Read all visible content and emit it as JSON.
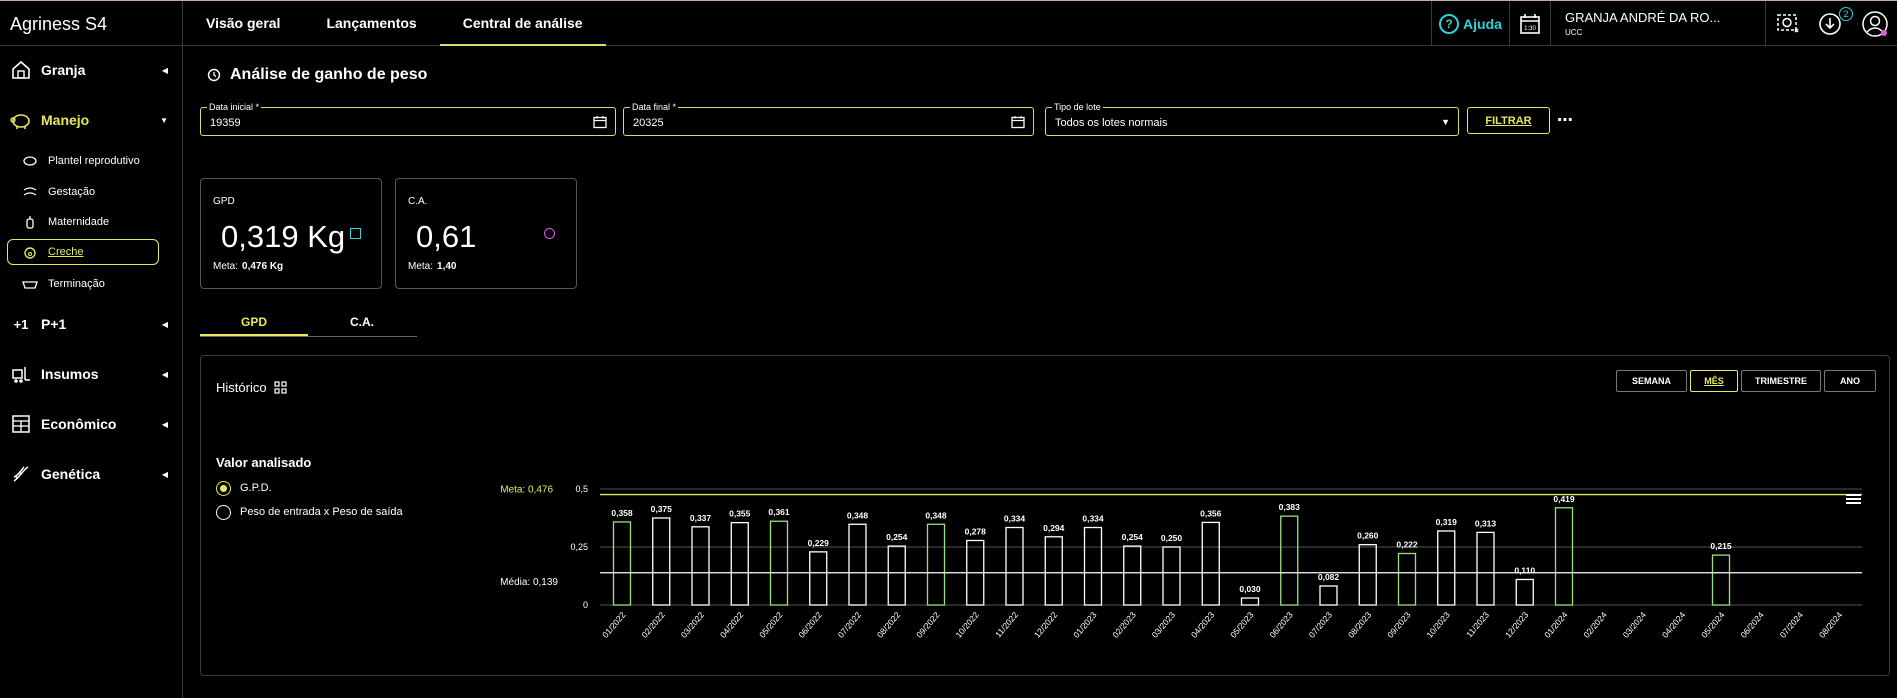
{
  "app": {
    "brand": "Agriness S4"
  },
  "topnav": [
    {
      "label": "Visão geral",
      "active": false
    },
    {
      "label": "Lançamentos",
      "active": false
    },
    {
      "label": "Central de análise",
      "active": true
    }
  ],
  "header": {
    "help_label": "Ajuda",
    "calendar_text": "1:30",
    "farm_name": "GRANJA ANDRÉ DA RO...",
    "farm_sub": "UCC",
    "notif_count": "2"
  },
  "sidebar": {
    "items": [
      {
        "label": "Granja",
        "icon": "barn-icon"
      },
      {
        "label": "Manejo",
        "icon": "pig-icon",
        "open": true
      },
      {
        "label": "P+1",
        "icon": "plus-one-icon"
      },
      {
        "label": "Insumos",
        "icon": "forklift-icon"
      },
      {
        "label": "Econômico",
        "icon": "ledger-icon"
      },
      {
        "label": "Genética",
        "icon": "dna-icon"
      }
    ],
    "subitems": [
      {
        "label": "Plantel reprodutivo",
        "icon": "sow-icon"
      },
      {
        "label": "Gestação",
        "icon": "gestation-icon"
      },
      {
        "label": "Maternidade",
        "icon": "bottle-icon"
      },
      {
        "label": "Creche",
        "icon": "piglet-icon",
        "active": true
      },
      {
        "label": "Terminação",
        "icon": "feeder-icon"
      }
    ]
  },
  "page": {
    "title": "Análise de ganho de peso"
  },
  "filters": {
    "start_label": "Data inicial *",
    "start_value": "19359",
    "end_label": "Data final *",
    "end_value": "20325",
    "lot_label": "Tipo de lote",
    "lot_value": "Todos os lotes normais",
    "filter_button": "FILTRAR"
  },
  "kpis": {
    "gpd": {
      "title": "GPD",
      "value": "0,319 Kg",
      "meta_label": "Meta:",
      "meta_value": "0,476 Kg"
    },
    "ca": {
      "title": "C.A.",
      "value": "0,61",
      "meta_label": "Meta:",
      "meta_value": "1,40"
    }
  },
  "metric_tabs": [
    {
      "label": "GPD",
      "active": true
    },
    {
      "label": "C.A.",
      "active": false
    }
  ],
  "history": {
    "title": "Histórico",
    "periods": [
      {
        "label": "SEMANA",
        "active": false
      },
      {
        "label": "MÊS",
        "active": true
      },
      {
        "label": "TRIMESTRE",
        "active": false
      },
      {
        "label": "ANO",
        "active": false
      }
    ],
    "analyzed_title": "Valor analisado",
    "options": [
      {
        "label": "G.P.D.",
        "selected": true
      },
      {
        "label": "Peso de entrada x Peso de saída",
        "selected": false
      }
    ]
  },
  "colors": {
    "accent": "#e8e85e",
    "cyan": "#2ed3d8",
    "green_bar": "#9be27a",
    "pink": "#d85ce0"
  },
  "chart_data": {
    "type": "bar",
    "categories": [
      "01/2022",
      "02/2022",
      "03/2022",
      "04/2022",
      "05/2022",
      "06/2022",
      "07/2022",
      "08/2022",
      "09/2022",
      "10/2022",
      "11/2022",
      "12/2022",
      "01/2023",
      "02/2023",
      "03/2023",
      "04/2023",
      "05/2023",
      "06/2023",
      "07/2023",
      "08/2023",
      "09/2023",
      "10/2023",
      "11/2023",
      "12/2023",
      "01/2024",
      "02/2024",
      "03/2024",
      "04/2024",
      "05/2024",
      "06/2024",
      "07/2024",
      "08/2024"
    ],
    "values": [
      0.358,
      0.375,
      0.337,
      0.355,
      0.361,
      0.229,
      0.348,
      0.254,
      0.348,
      0.278,
      0.334,
      0.294,
      0.334,
      0.254,
      0.25,
      0.356,
      0.03,
      0.383,
      0.082,
      0.26,
      0.222,
      0.319,
      0.313,
      0.11,
      0.419,
      null,
      null,
      null,
      0.215,
      null,
      null,
      null
    ],
    "value_labels": [
      "0,358",
      "0,375",
      "0,337",
      "0,355",
      "0,361",
      "0,229",
      "0,348",
      "0,254",
      "0,348",
      "0,278",
      "0,334",
      "0,294",
      "0,334",
      "0,254",
      "0,250",
      "0,356",
      "0,030",
      "0,383",
      "0,082",
      "0,260",
      "0,222",
      "0,319",
      "0,313",
      "0,110",
      "0,419",
      "",
      "",
      "",
      "0,215",
      "",
      "",
      ""
    ],
    "meta": 0.476,
    "meta_label": "Meta:",
    "meta_value": "0,476",
    "media": 0.139,
    "media_label": "Média:",
    "media_value": "0,139",
    "yticks": [
      {
        "v": 0,
        "label": "0"
      },
      {
        "v": 0.25,
        "label": "0,25"
      },
      {
        "v": 0.5,
        "label": "0,5"
      }
    ],
    "ylim": [
      0,
      0.5
    ],
    "grid": true
  }
}
